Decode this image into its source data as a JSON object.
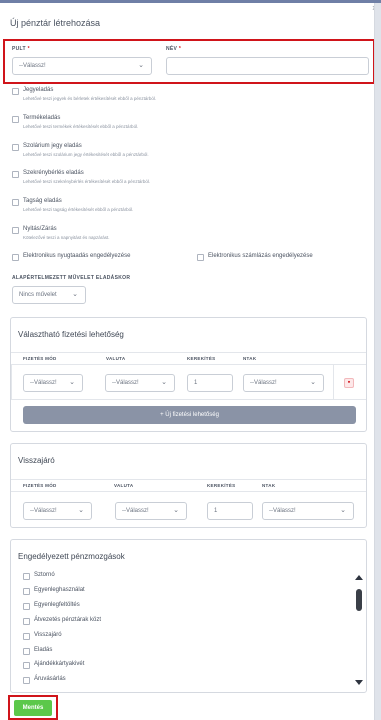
{
  "modal": {
    "title": "Új pénztár létrehozása",
    "close": "×"
  },
  "form": {
    "pult_label": "PULT",
    "pult_required": "*",
    "pult_value": "--Válassz!",
    "nev_label": "NÉV",
    "nev_required": "*",
    "nev_value": ""
  },
  "options": [
    {
      "label": "Jegyeladás",
      "desc": "Lehetővé teszi jegyek és bérletek értékesítését ebből a pénztárból."
    },
    {
      "label": "Termékeladás",
      "desc": "Lehetővé teszi termékek értékesítését ebből a pénztárból."
    },
    {
      "label": "Szolárium jegy eladás",
      "desc": "Lehetővé teszi szolárium jegy értékesítését ebből a pénztárból."
    },
    {
      "label": "Szekrénybérlés eladás",
      "desc": "Lehetővé teszi szekrénybérlés értékesítését ebből a pénztárból."
    },
    {
      "label": "Tagság eladás",
      "desc": "Lehetővé teszi tagság értékesítését ebből a pénztárból."
    },
    {
      "label": "Nyitás/Zárás",
      "desc": "Kötelezővé teszi a napnyitást és napzárást."
    }
  ],
  "extra_options": {
    "nyugtaadas": "Elektronikus nyugtaadás engedélyezése",
    "szamlazas": "Elektronikus számlázás engedélyezése"
  },
  "default_action": {
    "label": "ALAPÉRTELMEZETT MŰVELET ELADÁSKOR",
    "value": "Nincs művelet"
  },
  "payment_panel": {
    "title": "Választható fizetési lehetőség",
    "columns": [
      "FIZETÉS MÓD",
      "VALUTA",
      "KEREKÍTÉS",
      "NTAK"
    ],
    "row": {
      "mode": "--Válassz!",
      "currency": "--Válassz!",
      "rounding": "1",
      "ntak": "--Válassz!"
    },
    "add_button": "+ Új fizetési lehetőség"
  },
  "change_panel": {
    "title": "Visszajáró",
    "columns": [
      "FIZETÉS MÓD",
      "VALUTA",
      "KEREKÍTÉS",
      "NTAK"
    ],
    "row": {
      "mode": "--Válassz!",
      "currency": "--Válassz!",
      "rounding": "1",
      "ntak": "--Válassz!"
    }
  },
  "movements_panel": {
    "title": "Engedélyezett pénzmozgások",
    "items": [
      "Sztornó",
      "Egyenleghasználat",
      "Egyenlegfeltöltés",
      "Átvezetés pénztárak közt",
      "Visszajáró",
      "Eladás",
      "Ajándékkártyakivét",
      "Áruvásárlás"
    ]
  },
  "save_button": "Mentés",
  "icons": {
    "chevron": "chevron-down-icon",
    "trash": "trash-icon",
    "close": "close-icon"
  },
  "colors": {
    "highlight": "#d0141a",
    "save": "#5cc84a",
    "add_button": "#8a93a6"
  }
}
